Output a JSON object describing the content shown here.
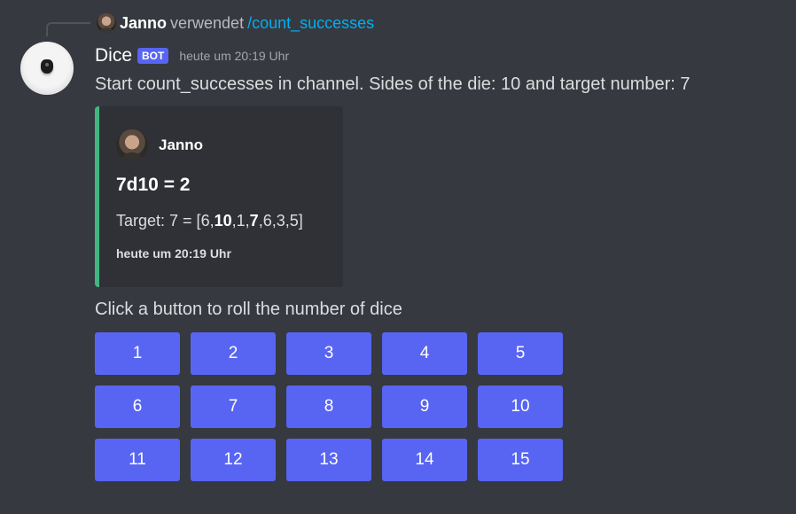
{
  "reply": {
    "username": "Janno",
    "verb": "verwendet",
    "command": "/count_successes"
  },
  "message": {
    "username": "Dice",
    "badge": "BOT",
    "timestamp": "heute um 20:19 Uhr",
    "content": "Start count_successes in channel. Sides of the die: 10 and target number: 7"
  },
  "embed": {
    "accent_color": "#43b581",
    "author": "Janno",
    "title": "7d10 = 2",
    "description_prefix": "Target: 7 = [",
    "rolls": [
      {
        "value": "6",
        "success": false
      },
      {
        "value": "10",
        "success": true
      },
      {
        "value": "1",
        "success": false
      },
      {
        "value": "7",
        "success": true
      },
      {
        "value": "6",
        "success": false
      },
      {
        "value": "3",
        "success": false
      },
      {
        "value": "5",
        "success": false
      }
    ],
    "description_suffix": "]",
    "footer": "heute um 20:19 Uhr"
  },
  "prompt": "Click a button to roll the number of dice",
  "buttons": [
    "1",
    "2",
    "3",
    "4",
    "5",
    "6",
    "7",
    "8",
    "9",
    "10",
    "11",
    "12",
    "13",
    "14",
    "15"
  ],
  "colors": {
    "background": "#36393f",
    "embed_background": "#2f3136",
    "button": "#5865f2",
    "command_link": "#00aff4"
  }
}
